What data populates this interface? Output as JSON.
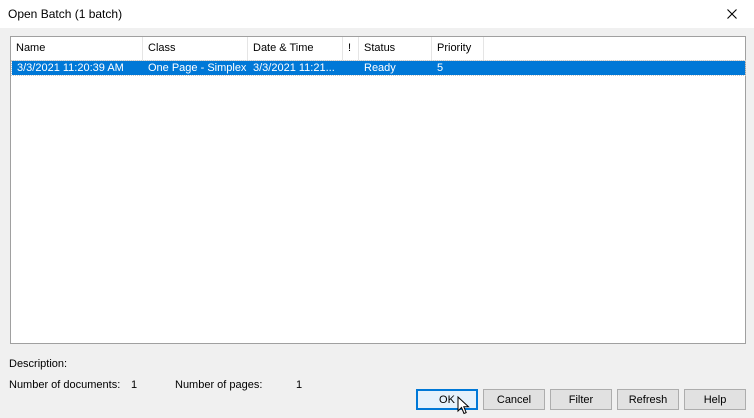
{
  "window": {
    "title": "Open Batch (1 batch)"
  },
  "table": {
    "columns": [
      "Name",
      "Class",
      "Date & Time",
      "!",
      "Status",
      "Priority"
    ],
    "rows": [
      [
        "3/3/2021 11:20:39 AM",
        "One Page - Simplex",
        "3/3/2021 11:21...",
        "",
        "Ready",
        "5"
      ]
    ]
  },
  "footer": {
    "description_label": "Description:",
    "num_documents_label": "Number of documents:",
    "num_documents_value": "1",
    "num_pages_label": "Number of pages:",
    "num_pages_value": "1"
  },
  "buttons": {
    "ok": "OK",
    "cancel": "Cancel",
    "filter": "Filter",
    "refresh": "Refresh",
    "help": "Help"
  },
  "icons": {
    "close": "close-icon",
    "cursor": "mouse-cursor-icon"
  },
  "colors": {
    "selection": "#0078d7",
    "default_button_border": "#0078d7"
  }
}
